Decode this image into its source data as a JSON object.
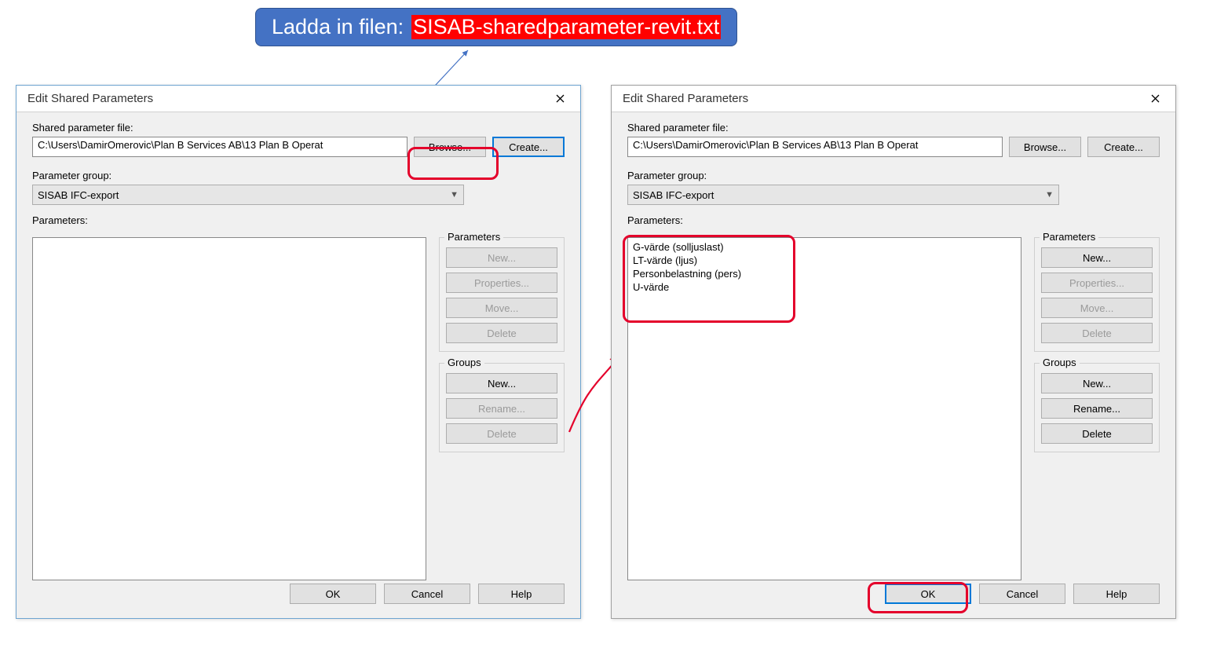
{
  "callout": {
    "prefix": "Ladda in filen:",
    "filename": "SISAB-sharedparameter-revit.txt"
  },
  "dialog": {
    "title": "Edit Shared Parameters",
    "labels": {
      "file": "Shared parameter file:",
      "group": "Parameter group:",
      "params": "Parameters:"
    },
    "file_path": "C:\\Users\\DamirOmerovic\\Plan B Services AB\\13 Plan B Operat",
    "group_selected": "SISAB IFC-export",
    "buttons": {
      "browse": "Browse...",
      "create": "Create...",
      "ok": "OK",
      "cancel": "Cancel",
      "help": "Help"
    },
    "param_panel": {
      "legend": "Parameters",
      "new": "New...",
      "properties": "Properties...",
      "move": "Move...",
      "delete": "Delete"
    },
    "groups_panel": {
      "legend": "Groups",
      "new": "New...",
      "rename": "Rename...",
      "delete": "Delete"
    }
  },
  "dialog2_params": [
    "G-värde (solljuslast)",
    "LT-värde (ljus)",
    "Personbelastning (pers)",
    "U-värde"
  ]
}
